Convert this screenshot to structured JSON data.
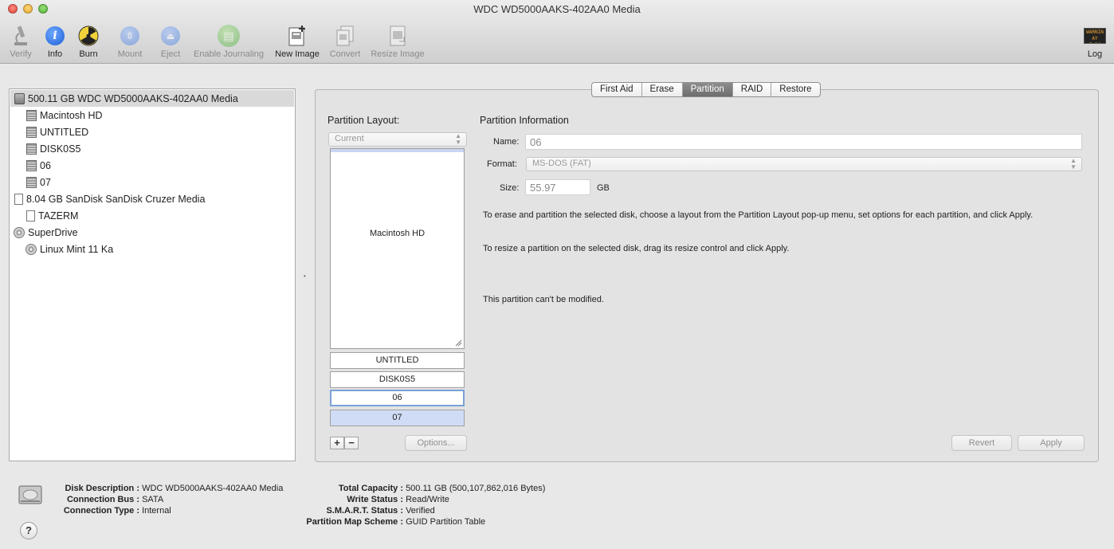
{
  "window": {
    "title": "WDC WD5000AAKS-402AA0 Media"
  },
  "toolbar": {
    "verify": "Verify",
    "info": "Info",
    "burn": "Burn",
    "mount": "Mount",
    "eject": "Eject",
    "enable_journaling": "Enable Journaling",
    "new_image": "New Image",
    "convert": "Convert",
    "resize_image": "Resize Image",
    "log": "Log",
    "log_badge_line1": "WARNIN",
    "log_badge_line2": "AY 7:36"
  },
  "sidebar": {
    "items": [
      {
        "label": "500.11 GB WDC WD5000AAKS-402AA0 Media",
        "icon": "hard-disk-icon",
        "selected": true
      },
      {
        "label": "Macintosh HD",
        "icon": "volume-icon"
      },
      {
        "label": "UNTITLED",
        "icon": "volume-icon"
      },
      {
        "label": "DISK0S5",
        "icon": "volume-icon"
      },
      {
        "label": "06",
        "icon": "volume-icon"
      },
      {
        "label": "07",
        "icon": "volume-icon"
      },
      {
        "label": "8.04 GB SanDisk SanDisk Cruzer Media",
        "icon": "usb-disk-icon"
      },
      {
        "label": "TAZERM",
        "icon": "usb-volume-icon"
      },
      {
        "label": "SuperDrive",
        "icon": "optical-drive-icon"
      },
      {
        "label": "Linux Mint 11 Ka",
        "icon": "disc-icon"
      }
    ]
  },
  "tabs": [
    "First Aid",
    "Erase",
    "Partition",
    "RAID",
    "Restore"
  ],
  "active_tab": "Partition",
  "partition": {
    "layout_heading": "Partition Layout:",
    "layout_value": "Current",
    "partitions": [
      "Macintosh HD",
      "UNTITLED",
      "DISK0S5",
      "06",
      "07"
    ],
    "info_heading": "Partition Information",
    "name_label": "Name:",
    "name_value": "06",
    "format_label": "Format:",
    "format_value": "MS-DOS (FAT)",
    "size_label": "Size:",
    "size_value": "55.97",
    "size_unit": "GB",
    "desc1": "To erase and partition the selected disk, choose a layout from the Partition Layout pop-up menu, set options for each partition, and click Apply.",
    "desc2": "To resize a partition on the selected disk, drag its resize control and click Apply.",
    "desc3": "This partition can't be modified.",
    "add_label": "+",
    "remove_label": "−",
    "options_label": "Options...",
    "revert_label": "Revert",
    "apply_label": "Apply"
  },
  "details": {
    "disk_description_k": "Disk Description :",
    "disk_description_v": "WDC WD5000AAKS-402AA0 Media",
    "connection_bus_k": "Connection Bus :",
    "connection_bus_v": "SATA",
    "connection_type_k": "Connection Type :",
    "connection_type_v": "Internal",
    "total_capacity_k": "Total Capacity :",
    "total_capacity_v": "500.11 GB (500,107,862,016 Bytes)",
    "write_status_k": "Write Status :",
    "write_status_v": "Read/Write",
    "smart_status_k": "S.M.A.R.T. Status :",
    "smart_status_v": "Verified",
    "partition_map_k": "Partition Map Scheme :",
    "partition_map_v": "GUID Partition Table",
    "help_label": "?"
  }
}
